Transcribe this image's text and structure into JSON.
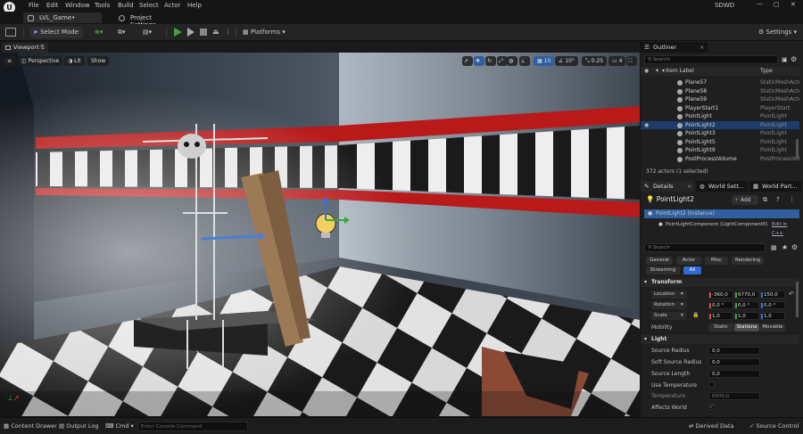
{
  "menubar": {
    "items": [
      "File",
      "Edit",
      "Window",
      "Tools",
      "Build",
      "Select",
      "Actor",
      "Help"
    ],
    "user": "SDWD"
  },
  "tabs": {
    "level": "LVL_Game•",
    "project_settings": "Project Settings"
  },
  "toolbar": {
    "select_mode": "Select Mode",
    "platforms": "Platforms",
    "settings": "Settings"
  },
  "viewport": {
    "tab_label": "Viewport 1",
    "perspective": "Perspective",
    "lit": "Lit",
    "show": "Show",
    "grid_snap": "10",
    "rot_snap": "10°",
    "scale_snap": "0.25",
    "camera_speed": "4"
  },
  "outliner": {
    "title": "Outliner",
    "search_placeholder": "Search",
    "col_label": "Item Label",
    "col_type": "Type",
    "rows": [
      {
        "name": "Plane57",
        "type": "StaticMeshActor"
      },
      {
        "name": "Plane58",
        "type": "StaticMeshActor"
      },
      {
        "name": "Plane59",
        "type": "StaticMeshActor"
      },
      {
        "name": "PlayerStart1",
        "type": "PlayerStart"
      },
      {
        "name": "PointLight",
        "type": "PointLight"
      },
      {
        "name": "PointLight2",
        "type": "PointLight"
      },
      {
        "name": "PointLight3",
        "type": "PointLight"
      },
      {
        "name": "PointLight5",
        "type": "PointLight"
      },
      {
        "name": "PointLight9",
        "type": "PointLight"
      },
      {
        "name": "PostProcessVolume",
        "type": "PostProcessVolume"
      }
    ],
    "status": "372 actors (1 selected)"
  },
  "details": {
    "tabs": [
      "Details",
      "World Sett...",
      "World Part..."
    ],
    "actor_name": "PointLight2",
    "add_label": "Add",
    "instance_label": "PointLight2 (Instance)",
    "component_label": "PointLightComponent (LightComponent0)",
    "edit_cpp": "Edit in C++",
    "search_placeholder": "Search",
    "filters": [
      "General",
      "Actor",
      "Misc",
      "Rendering",
      "Streaming",
      "All"
    ],
    "transform_title": "Transform",
    "location_label": "Location",
    "location": [
      "-360,0",
      "6770,0",
      "150,0"
    ],
    "rotation_label": "Rotation",
    "rotation": [
      "0,0 °",
      "0,0 °",
      "0,0 °"
    ],
    "scale_label": "Scale",
    "scale": [
      "1,0",
      "1,0",
      "1,0"
    ],
    "mobility_label": "Mobility",
    "mobility": [
      "Static",
      "Stationa",
      "Movable"
    ],
    "light_title": "Light",
    "source_radius_label": "Source Radius",
    "source_radius": "0,0",
    "soft_source_radius_label": "Soft Source Radius",
    "soft_source_radius": "0,0",
    "source_length_label": "Source Length",
    "source_length": "0,0",
    "use_temperature_label": "Use Temperature",
    "temperature_label": "Temperature",
    "temperature": "6500,0",
    "affects_world_label": "Affects World"
  },
  "bottombar": {
    "content_drawer": "Content Drawer",
    "output_log": "Output Log",
    "cmd": "Cmd",
    "console_placeholder": "Enter Console Command",
    "derived_data": "Derived Data",
    "source_control": "Source Control"
  },
  "colors": {
    "accent": "#1c3d6b",
    "play": "#3fa33f",
    "selection": "#2e5f9e"
  }
}
